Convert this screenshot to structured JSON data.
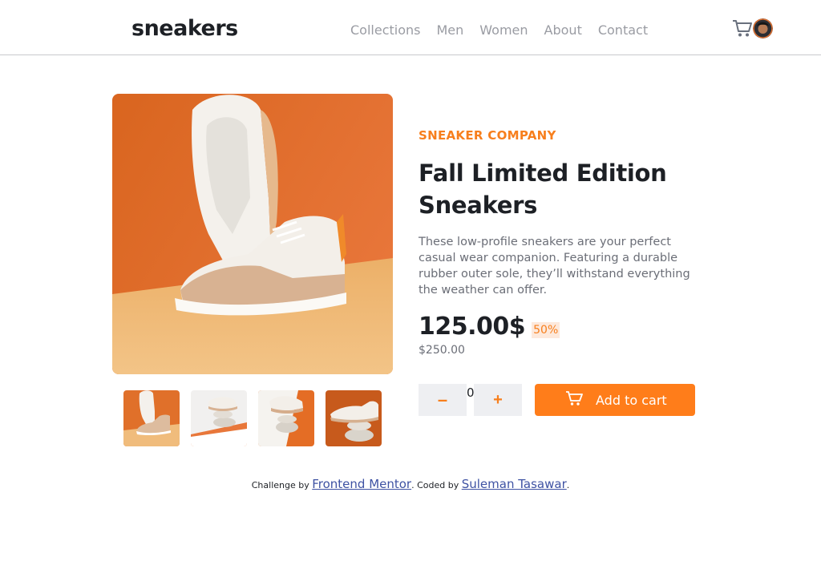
{
  "header": {
    "logo": "sneakers",
    "nav": [
      "Collections",
      "Men",
      "Women",
      "About",
      "Contact"
    ]
  },
  "product": {
    "company": "SNEAKER COMPANY",
    "title": "Fall Limited Edition Sneakers",
    "description": "These low-profile sneakers are your perfect casual wear companion. Featuring a durable rubber outer sole, they’ll withstand everything the weather can offer.",
    "price": "125.00$",
    "discount": "50%",
    "old_price": "$250.00",
    "quantity": "0",
    "minus_label": "–",
    "plus_label": "+",
    "add_to_cart": "Add to cart"
  },
  "footer": {
    "challenge_by": "Challenge by",
    "mentor_link": "Frontend Mentor",
    "coded_by": ". Coded by",
    "author_link": "Suleman Tasawar",
    "end": "."
  },
  "colors": {
    "accent": "#ff7d1a",
    "accent_text": "#f77f1d",
    "link": "#3e52a3"
  }
}
